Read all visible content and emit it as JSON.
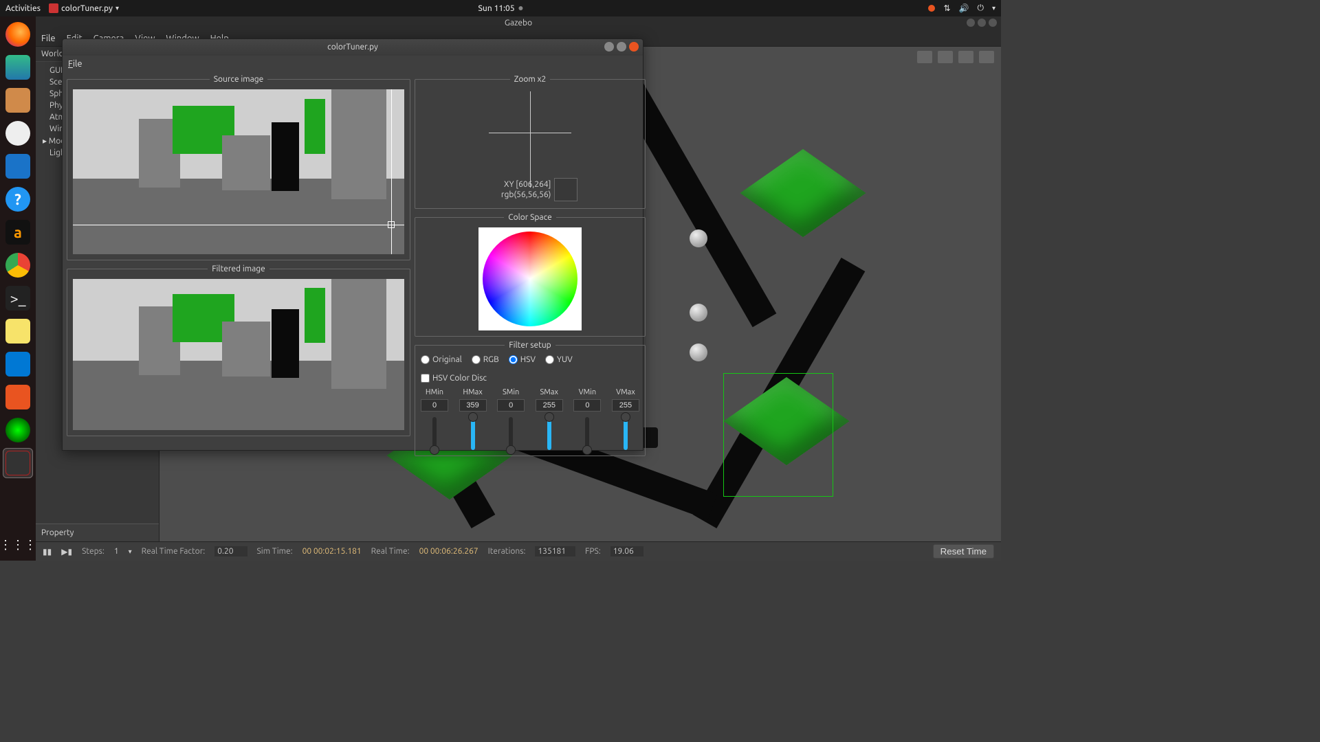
{
  "top_panel": {
    "activities": "Activities",
    "app_name": "colorTuner.py",
    "clock": "Sun 11:05"
  },
  "gazebo": {
    "title": "Gazebo",
    "menu": [
      "File",
      "Edit",
      "Camera",
      "View",
      "Window",
      "Help"
    ],
    "sidebar_tab": "World",
    "tree": [
      "GUI",
      "Scene",
      "Spherical Coordinates",
      "Physics",
      "Atmosphere",
      "Wind",
      "Models",
      "Lights"
    ],
    "property_label": "Property",
    "bottom": {
      "steps_label": "Steps:",
      "steps_value": "1",
      "rtf_label": "Real Time Factor:",
      "rtf_value": "0.20",
      "sim_label": "Sim Time:",
      "sim_value": "00 00:02:15.181",
      "real_label": "Real Time:",
      "real_value": "00 00:06:26.267",
      "iter_label": "Iterations:",
      "iter_value": "135181",
      "fps_label": "FPS:",
      "fps_value": "19.06",
      "reset": "Reset Time"
    }
  },
  "ct": {
    "title": "colorTuner.py",
    "menu_file": "File",
    "source_label": "Source image",
    "filtered_label": "Filtered image",
    "zoom_label": "Zoom x2",
    "zoom_xy": "XY [606,264]",
    "zoom_rgb": "rgb(56,56,56)",
    "colorspace_label": "Color Space",
    "filter_label": "Filter setup",
    "radios": {
      "original": "Original",
      "rgb": "RGB",
      "hsv": "HSV",
      "yuv": "YUV",
      "disc": "HSV Color Disc"
    },
    "sliders": [
      {
        "label": "HMin",
        "value": "0",
        "fill": 0
      },
      {
        "label": "HMax",
        "value": "359",
        "fill": 100
      },
      {
        "label": "SMin",
        "value": "0",
        "fill": 0
      },
      {
        "label": "SMax",
        "value": "255",
        "fill": 100
      },
      {
        "label": "VMin",
        "value": "0",
        "fill": 0
      },
      {
        "label": "VMax",
        "value": "255",
        "fill": 100
      }
    ]
  }
}
